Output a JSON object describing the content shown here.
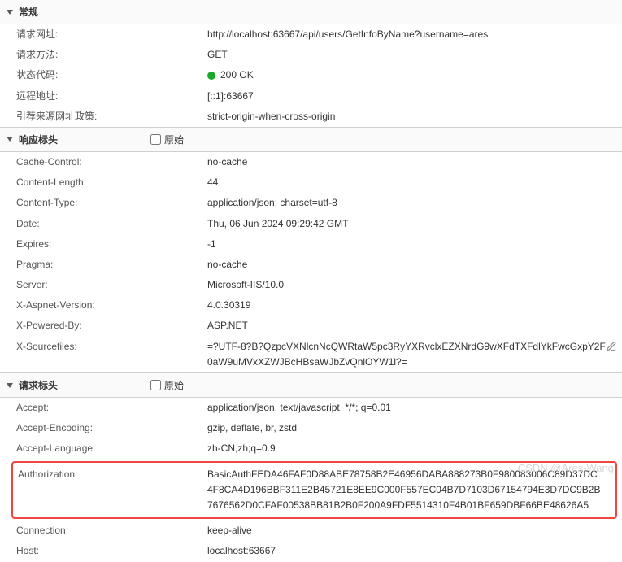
{
  "sections": {
    "general": {
      "title": "常规",
      "rows": {
        "request_url": {
          "label": "请求网址:",
          "value": "http://localhost:63667/api/users/GetInfoByName?username=ares"
        },
        "request_method": {
          "label": "请求方法:",
          "value": "GET"
        },
        "status_code": {
          "label": "状态代码:",
          "value": "200 OK"
        },
        "remote_address": {
          "label": "远程地址:",
          "value": "[::1]:63667"
        },
        "referrer_policy": {
          "label": "引荐来源网址政策:",
          "value": "strict-origin-when-cross-origin"
        }
      }
    },
    "response": {
      "title": "响应标头",
      "raw_label": "原始",
      "rows": {
        "cache_control": {
          "label": "Cache-Control:",
          "value": "no-cache"
        },
        "content_length": {
          "label": "Content-Length:",
          "value": "44"
        },
        "content_type": {
          "label": "Content-Type:",
          "value": "application/json; charset=utf-8"
        },
        "date": {
          "label": "Date:",
          "value": "Thu, 06 Jun 2024 09:29:42 GMT"
        },
        "expires": {
          "label": "Expires:",
          "value": "-1"
        },
        "pragma": {
          "label": "Pragma:",
          "value": "no-cache"
        },
        "server": {
          "label": "Server:",
          "value": "Microsoft-IIS/10.0"
        },
        "x_aspnet_version": {
          "label": "X-Aspnet-Version:",
          "value": "4.0.30319"
        },
        "x_powered_by": {
          "label": "X-Powered-By:",
          "value": "ASP.NET"
        },
        "x_sourcefiles": {
          "label": "X-Sourcefiles:",
          "value": "=?UTF-8?B?QzpcVXNlcnNcQWRtaW5pc3RyYXRvclxEZXNrdG9wXFdTXFdlYkFwcGxpY2F0aW9uMVxXZWJBcHBsaWJbZvQnlOYW1l?="
        }
      }
    },
    "request": {
      "title": "请求标头",
      "raw_label": "原始",
      "rows": {
        "accept": {
          "label": "Accept:",
          "value": "application/json, text/javascript, */*; q=0.01"
        },
        "accept_encoding": {
          "label": "Accept-Encoding:",
          "value": "gzip, deflate, br, zstd"
        },
        "accept_language": {
          "label": "Accept-Language:",
          "value": "zh-CN,zh;q=0.9"
        },
        "authorization": {
          "label": "Authorization:",
          "value": "BasicAuthFEDA46FAF0D88ABE78758B2E46956DABA888273B0F980083006C89D37DC4F8CA4D196BBF311E2B45721E8EE9C000F557EC04B7D7103D67154794E3D7DC9B2B7676562D0CFAF00538BB81B2B0F200A9FDF5514310F4B01BF659DBF66BE48626A5"
        },
        "connection": {
          "label": "Connection:",
          "value": "keep-alive"
        },
        "host": {
          "label": "Host:",
          "value": "localhost:63667"
        }
      }
    }
  },
  "watermark": "CSDN @Ares-Wang"
}
